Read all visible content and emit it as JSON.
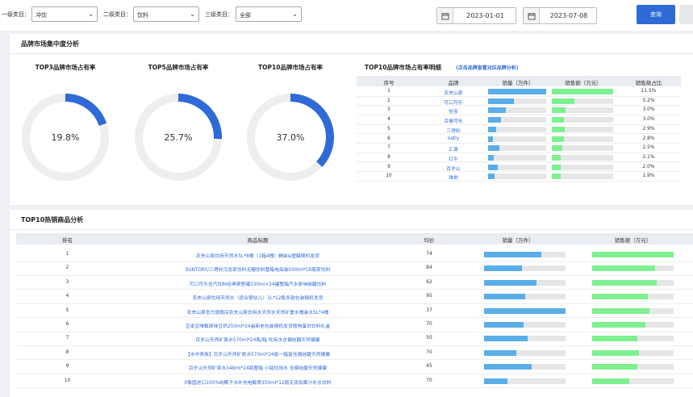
{
  "filters": {
    "level1": {
      "label": "一级类目：",
      "value": "冲饮"
    },
    "level2": {
      "label": "二级类目：",
      "value": "饮料"
    },
    "level3": {
      "label": "三级类目：",
      "value": "全部"
    },
    "start_date": "2023-01-01",
    "end_date": "2023-07-08",
    "query_label": "查询"
  },
  "brand_panel": {
    "title": "品牌市场集中度分析",
    "gauges": [
      {
        "title": "TOP3品牌市场占有率",
        "value_text": "19.8%",
        "value": 0.198
      },
      {
        "title": "TOP5品牌市场占有率",
        "value_text": "25.7%",
        "value": 0.257
      },
      {
        "title": "TOP10品牌市场占有率",
        "value_text": "37.0%",
        "value": 0.37
      }
    ],
    "detail_title": "TOP10品牌市场占有率明细",
    "detail_hint": "(点击品牌查看对应品牌分析)",
    "columns": [
      "序号",
      "品牌",
      "销量（万件）",
      "销售额（万元）",
      "销售额占比"
    ],
    "rows": [
      {
        "no": "1",
        "brand": "农夫山泉",
        "qty": 1.0,
        "sales": 1.0,
        "share": "11.5%"
      },
      {
        "no": "2",
        "brand": "可口可乐",
        "qty": 0.45,
        "sales": 0.37,
        "share": "5.2%"
      },
      {
        "no": "3",
        "brand": "怡宝",
        "qty": 0.3,
        "sales": 0.22,
        "share": "3.0%"
      },
      {
        "no": "4",
        "brand": "百事可乐",
        "qty": 0.22,
        "sales": 0.2,
        "share": "3.0%"
      },
      {
        "no": "5",
        "brand": "三得利",
        "qty": 0.14,
        "sales": 0.21,
        "share": "2.9%"
      },
      {
        "no": "6",
        "brand": "oatly",
        "qty": 0.09,
        "sales": 0.2,
        "share": "2.8%"
      },
      {
        "no": "7",
        "brand": "汇源",
        "qty": 0.2,
        "sales": 0.17,
        "share": "2.5%"
      },
      {
        "no": "8",
        "brand": "红牛",
        "qty": 0.1,
        "sales": 0.15,
        "share": "2.1%"
      },
      {
        "no": "9",
        "brand": "百岁山",
        "qty": 0.16,
        "sales": 0.14,
        "share": "2.0%"
      },
      {
        "no": "10",
        "brand": "维他",
        "qty": 0.11,
        "sales": 0.14,
        "share": "1.9%"
      }
    ]
  },
  "product_panel": {
    "title": "TOP10热销商品分析",
    "columns": [
      "排名",
      "商品标题",
      "均价",
      "销量（万件）",
      "销售额（万元）"
    ],
    "rows": [
      {
        "rank": "1",
        "title": "农夫山泉饮用天然水5L*8桶（1箱4桶）精装&塑膜随机发货",
        "price": "74",
        "qty": 0.7,
        "sales": 1.0
      },
      {
        "rank": "2",
        "title": "SUNTORY/三得利乌龙茶饮料无糖饮料整箱电商装500ml*18瓶茶饮料",
        "price": "84",
        "qty": 0.47,
        "sales": 0.77
      },
      {
        "rank": "3",
        "title": "可口可乐含汽饮料经典摩登罐330ml×24罐整箱汽水原味碳酸饮料",
        "price": "62",
        "qty": 0.64,
        "sales": 0.79
      },
      {
        "rank": "4",
        "title": "农夫山泉饮用天然水（适合婴幼儿）1L*12瓶多款包装随机发货",
        "price": "95",
        "qty": 0.5,
        "sales": 0.68
      },
      {
        "rank": "5",
        "title": "农夫山泉官方旗舰店农夫山泉饮用水天然水天然矿重水桶装水5L*4桶",
        "price": "37",
        "qty": 1.0,
        "sales": 0.7
      },
      {
        "rank": "6",
        "title": "豆本豆唯甄原味豆奶250ml*24盒新老包装随机发货植物蛋白饮料礼盒",
        "price": "70",
        "qty": 0.49,
        "sales": 0.65
      },
      {
        "rank": "7",
        "title": "百岁山天然矿泉水570ml*24瓶/箱 饮用水含偏硅酸天然健康",
        "price": "50",
        "qty": 0.53,
        "sales": 0.55
      },
      {
        "rank": "8",
        "title": "【水中贵族】百岁山天然矿泉水570ml*24瓶一箱富含偏硅酸天然健康",
        "price": "70",
        "qty": 0.4,
        "sales": 0.57
      },
      {
        "rank": "9",
        "title": "百岁山天然矿泉水348ml*24瓶整箱 小瓶饮用水 含偏硅酸天然健康",
        "price": "45",
        "qty": 0.58,
        "sales": 0.55
      },
      {
        "rank": "10",
        "title": "if泰国进口100%纯椰子水补充电解质350ml*12瓶无添加果汁补水饮料",
        "price": "70",
        "qty": 0.29,
        "sales": 0.46
      }
    ]
  },
  "colors": {
    "primary": "#2f6bd6",
    "qty_bar": "#5aaee8",
    "sales_bar": "#7ef08f",
    "ring_bg": "#eeeeee"
  }
}
